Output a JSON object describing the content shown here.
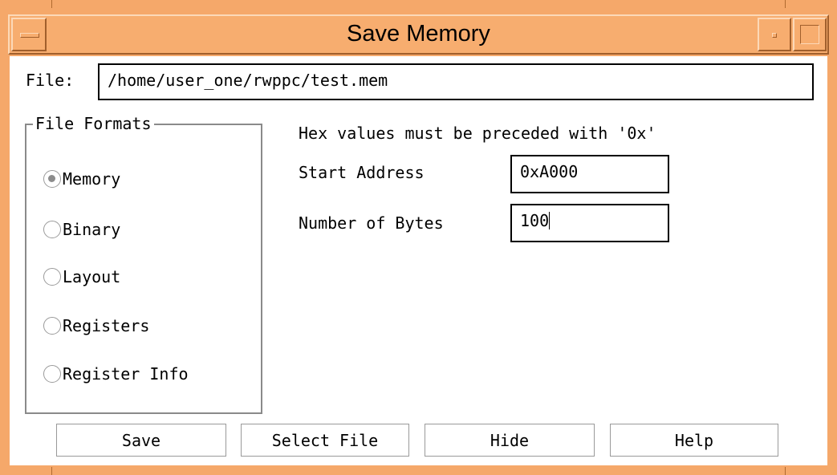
{
  "window": {
    "title": "Save Memory"
  },
  "file": {
    "label": "File:",
    "value": "/home/user_one/rwppc/test.mem"
  },
  "formats": {
    "legend": "File Formats",
    "options": [
      {
        "label": "Memory",
        "checked": true
      },
      {
        "label": "Binary",
        "checked": false
      },
      {
        "label": "Layout",
        "checked": false
      },
      {
        "label": "Registers",
        "checked": false
      },
      {
        "label": "Register Info",
        "checked": false
      }
    ]
  },
  "hint": "Hex values must be preceded with '0x'",
  "start_address": {
    "label": "Start Address",
    "value": "0xA000"
  },
  "num_bytes": {
    "label": "Number of Bytes",
    "value": "100"
  },
  "buttons": {
    "save": "Save",
    "select_file": "Select File",
    "hide": "Hide",
    "help": "Help"
  },
  "colors": {
    "frame": "#f5a86a",
    "background": "#ffffff"
  }
}
